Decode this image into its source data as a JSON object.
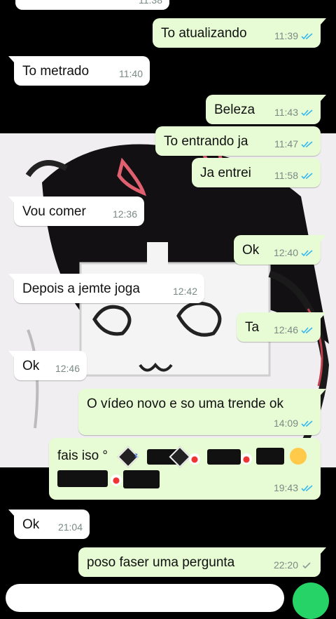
{
  "chat": {
    "messages": [
      {
        "id": "m1",
        "dir": "out",
        "text": "To atualizando",
        "time": "11:39",
        "status": "read"
      },
      {
        "id": "m2",
        "dir": "in",
        "text": "To metrado",
        "time": "11:40"
      },
      {
        "id": "m3",
        "dir": "out",
        "text": "Beleza",
        "time": "11:43",
        "status": "read"
      },
      {
        "id": "m4",
        "dir": "out",
        "text": "To entrando ja",
        "time": "11:47",
        "status": "read"
      },
      {
        "id": "m5",
        "dir": "out",
        "text": "Ja entrei",
        "time": "11:58",
        "status": "read"
      },
      {
        "id": "m6",
        "dir": "in",
        "text": "Vou comer",
        "time": "12:36"
      },
      {
        "id": "m7",
        "dir": "out",
        "text": "Ok",
        "time": "12:40",
        "status": "read"
      },
      {
        "id": "m8",
        "dir": "in",
        "text": "Depois a jemte joga",
        "time": "12:42"
      },
      {
        "id": "m9",
        "dir": "out",
        "text": "Ta",
        "time": "12:46",
        "status": "read"
      },
      {
        "id": "m10",
        "dir": "in",
        "text": "Ok",
        "time": "12:46"
      },
      {
        "id": "m11",
        "dir": "out",
        "text": "O vídeo novo e so uma trende ok",
        "time": "14:09",
        "status": "read"
      },
      {
        "id": "m12",
        "dir": "out",
        "text": "fais iso °",
        "time": "19:43",
        "status": "read"
      },
      {
        "id": "m13",
        "dir": "in",
        "text": "Ok",
        "time": "21:04"
      },
      {
        "id": "m14",
        "dir": "out",
        "text": "poso faser uma pergunta",
        "time": "22:20",
        "status": "sent"
      }
    ],
    "top_partial_time": "11:38"
  },
  "colors": {
    "outgoing_bubble": "#e7fcd4",
    "incoming_bubble": "#ffffff",
    "read_ticks": "#34b7f1",
    "sent_tick": "#8a9a94",
    "accent": "#25d366"
  },
  "icons": {
    "read": "double-check-icon",
    "sent": "single-check-icon",
    "fab": "send-icon"
  }
}
